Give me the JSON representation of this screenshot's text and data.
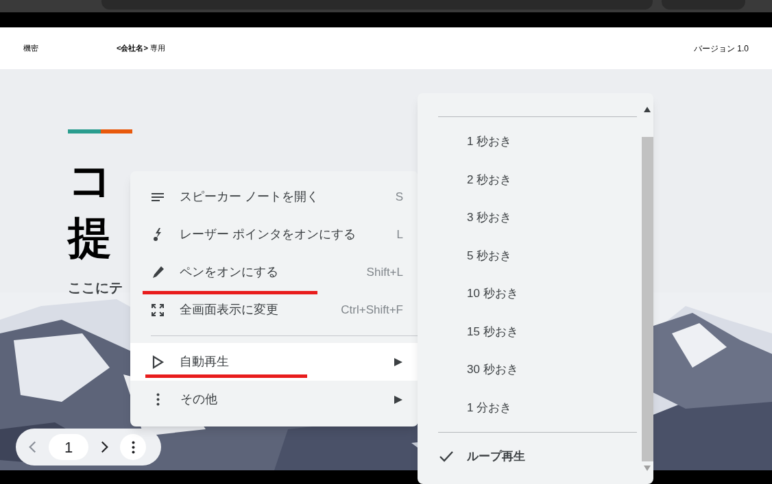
{
  "header": {
    "label": "機密",
    "company": "**<会社名>** 専用",
    "version": "バージョン 1.0"
  },
  "slide": {
    "title_lines": [
      "コ",
      "提"
    ],
    "subtitle": "ここにテ"
  },
  "context_menu": {
    "groups": [
      [
        {
          "kind": "item",
          "label": "スピーカー ノートを開く",
          "shortcut": "S",
          "selected": false
        },
        {
          "kind": "item",
          "label": "レーザー ポインタをオンにする",
          "shortcut": "L",
          "selected": false
        },
        {
          "kind": "item",
          "label": "ペンをオンにする",
          "shortcut": "Shift+L",
          "selected": false
        },
        {
          "kind": "item",
          "label": "全画面表示に変更",
          "shortcut": "Ctrl+Shift+F",
          "selected": false
        }
      ],
      [
        {
          "kind": "submenu",
          "label": "自動再生",
          "selected": true
        },
        {
          "kind": "submenu",
          "label": "その他",
          "selected": false
        }
      ]
    ]
  },
  "autoplay_menu": {
    "intervals": [
      {
        "label": "1 秒おき",
        "selected": false
      },
      {
        "label": "2 秒おき",
        "selected": false
      },
      {
        "label": "3 秒おき",
        "selected": false
      },
      {
        "label": "5 秒おき",
        "selected": false
      },
      {
        "label": "10 秒おき",
        "selected": false
      },
      {
        "label": "15 秒おき",
        "selected": false
      },
      {
        "label": "30 秒おき",
        "selected": false
      },
      {
        "label": "1 分おき",
        "selected": false
      }
    ],
    "loop": {
      "label": "ループ再生",
      "checked": true
    }
  },
  "navigation": {
    "page": "1"
  }
}
